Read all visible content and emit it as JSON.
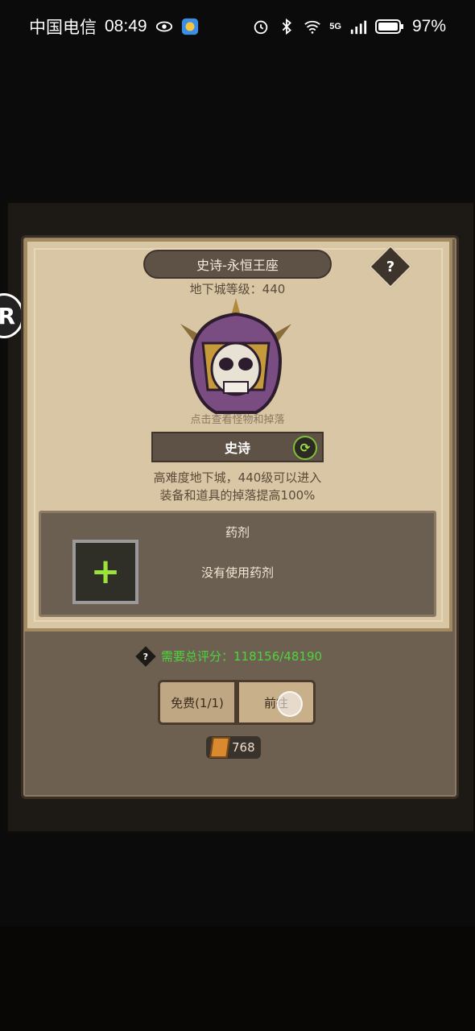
{
  "status_bar": {
    "carrier": "中国电信",
    "time": "08:49",
    "network": "5G",
    "battery": "97%"
  },
  "dialog": {
    "title": "史诗-永恒王座",
    "help_label": "?",
    "dungeon_level": "地下城等级：440",
    "hint": "点击查看怪物和掉落",
    "difficulty": "史诗",
    "desc_line1": "高难度地下城，440级可以进入",
    "desc_line2": "装备和道具的掉落提高100%",
    "potion": {
      "title": "药剂",
      "empty_text": "没有使用药剂"
    },
    "score": {
      "label": "需要总评分：118156/48190"
    },
    "buttons": {
      "free": "免费(1/1)",
      "go": "前往"
    },
    "currency_amount": "768"
  },
  "colors": {
    "score_green": "#4ed33e",
    "plus_green": "#9be23b",
    "parchment": "#d8c6a4"
  }
}
